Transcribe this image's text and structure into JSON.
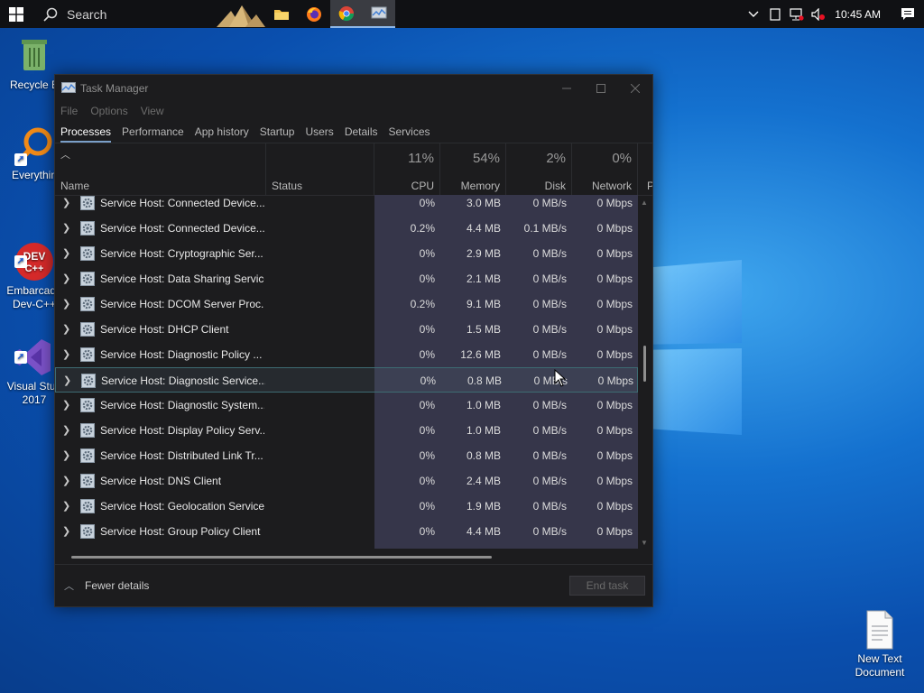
{
  "taskbar": {
    "search_placeholder": "Search",
    "clock": "10:45 AM",
    "apps": [
      "file-explorer",
      "firefox",
      "chrome",
      "task-manager"
    ]
  },
  "desktop": {
    "icons": [
      {
        "label": "Recycle Bin",
        "visible_label": "Recycle B"
      },
      {
        "label": "Everything",
        "visible_label": "Everythin"
      },
      {
        "label": "Embarcadero Dev-C++",
        "visible_label": "Embarcade\nDev-C++"
      },
      {
        "label": "Visual Studio 2017",
        "visible_label": "Visual Stud\n2017"
      },
      {
        "label": "New Text Document",
        "visible_label": "New Text\nDocument"
      }
    ]
  },
  "task_manager": {
    "title": "Task Manager",
    "menu": [
      "File",
      "Options",
      "View"
    ],
    "tabs": [
      "Processes",
      "Performance",
      "App history",
      "Startup",
      "Users",
      "Details",
      "Services"
    ],
    "active_tab": "Processes",
    "columns": {
      "name": "Name",
      "status": "Status",
      "cpu": {
        "pct": "11%",
        "label": "CPU"
      },
      "memory": {
        "pct": "54%",
        "label": "Memory"
      },
      "disk": {
        "pct": "2%",
        "label": "Disk"
      },
      "network": {
        "pct": "0%",
        "label": "Network"
      },
      "power": "P"
    },
    "rows": [
      {
        "name": "Service Host: Connected Device...",
        "cpu": "0%",
        "memory": "3.0 MB",
        "disk": "0 MB/s",
        "network": "0 Mbps"
      },
      {
        "name": "Service Host: Connected Device...",
        "cpu": "0.2%",
        "memory": "4.4 MB",
        "disk": "0.1 MB/s",
        "network": "0 Mbps"
      },
      {
        "name": "Service Host: Cryptographic Ser...",
        "cpu": "0%",
        "memory": "2.9 MB",
        "disk": "0 MB/s",
        "network": "0 Mbps"
      },
      {
        "name": "Service Host: Data Sharing Service",
        "cpu": "0%",
        "memory": "2.1 MB",
        "disk": "0 MB/s",
        "network": "0 Mbps"
      },
      {
        "name": "Service Host: DCOM Server Proc...",
        "cpu": "0.2%",
        "memory": "9.1 MB",
        "disk": "0 MB/s",
        "network": "0 Mbps"
      },
      {
        "name": "Service Host: DHCP Client",
        "cpu": "0%",
        "memory": "1.5 MB",
        "disk": "0 MB/s",
        "network": "0 Mbps"
      },
      {
        "name": "Service Host: Diagnostic Policy ...",
        "cpu": "0%",
        "memory": "12.6 MB",
        "disk": "0 MB/s",
        "network": "0 Mbps"
      },
      {
        "name": "Service Host: Diagnostic Service...",
        "cpu": "0%",
        "memory": "0.8 MB",
        "disk": "0 MB/s",
        "network": "0 Mbps",
        "selected": true
      },
      {
        "name": "Service Host: Diagnostic System...",
        "cpu": "0%",
        "memory": "1.0 MB",
        "disk": "0 MB/s",
        "network": "0 Mbps"
      },
      {
        "name": "Service Host: Display Policy Serv...",
        "cpu": "0%",
        "memory": "1.0 MB",
        "disk": "0 MB/s",
        "network": "0 Mbps"
      },
      {
        "name": "Service Host: Distributed Link Tr...",
        "cpu": "0%",
        "memory": "0.8 MB",
        "disk": "0 MB/s",
        "network": "0 Mbps"
      },
      {
        "name": "Service Host: DNS Client",
        "cpu": "0%",
        "memory": "2.4 MB",
        "disk": "0 MB/s",
        "network": "0 Mbps"
      },
      {
        "name": "Service Host: Geolocation Service",
        "cpu": "0%",
        "memory": "1.9 MB",
        "disk": "0 MB/s",
        "network": "0 Mbps"
      },
      {
        "name": "Service Host: Group Policy Client",
        "cpu": "0%",
        "memory": "4.4 MB",
        "disk": "0 MB/s",
        "network": "0 Mbps"
      }
    ],
    "footer": {
      "fewer_details": "Fewer details",
      "end_task": "End task"
    }
  },
  "colors": {
    "heat_cell": "#36364a",
    "selected_border": "#3d6b72",
    "window_bg": "#1c1c1e",
    "taskbar_bg": "#101114"
  }
}
